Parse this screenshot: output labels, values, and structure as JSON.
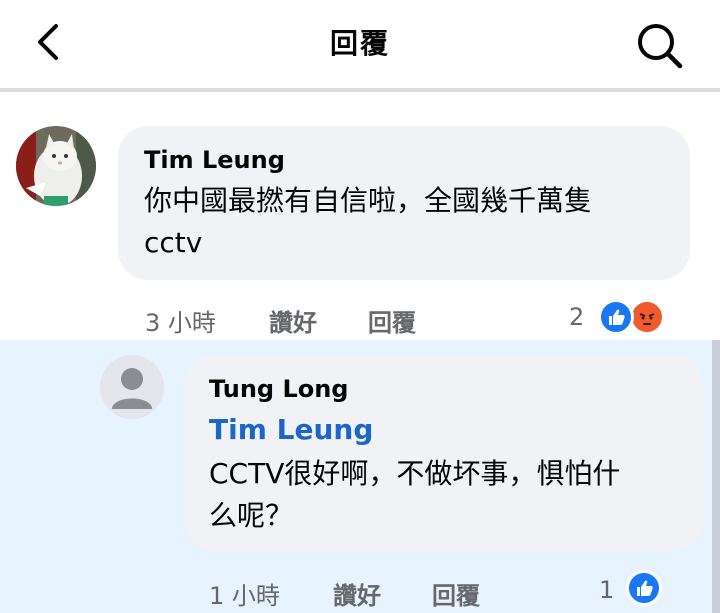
{
  "header": {
    "title": "回覆",
    "back_icon": "chevron-left-icon",
    "search_icon": "search-icon"
  },
  "comments": [
    {
      "author": "Tim Leung",
      "text_line1": "你中國最撚有自信啦，全國幾千萬隻",
      "text_line2": "cctv",
      "time": "3 小時",
      "like_label": "讚好",
      "reply_label": "回覆",
      "reaction_count": "2",
      "reactions": [
        "like-icon",
        "angry-icon"
      ]
    },
    {
      "author": "Tung Long",
      "mention": "Tim Leung",
      "text_line1": "CCTV很好啊，不做坏事，惧怕什",
      "text_line2": "么呢？",
      "time": "1 小時",
      "like_label": "讚好",
      "reply_label": "回覆",
      "reaction_count": "1",
      "reactions": [
        "like-icon"
      ]
    }
  ],
  "colors": {
    "reply_highlight": "#e7f3ff",
    "bubble": "#f0f2f5",
    "mention": "#1b66c9",
    "like": "#1877f2",
    "angry": "#f15a2d"
  }
}
